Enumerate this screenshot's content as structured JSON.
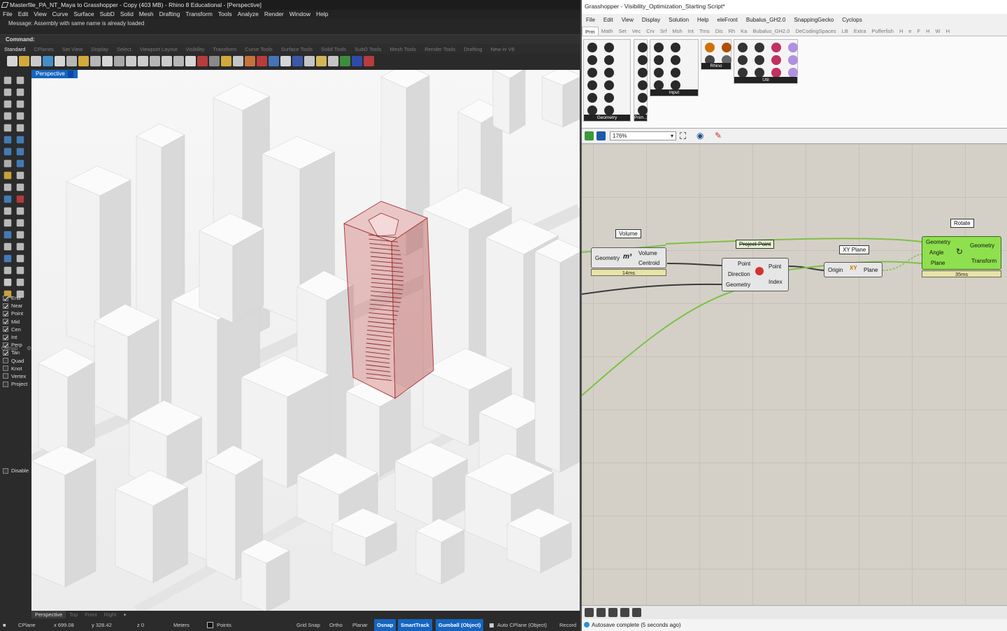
{
  "rhino": {
    "title": "Masterfile_PA_NT_Maya to Grasshopper - Copy (403 MB) - Rhino 8 Educational - [Perspective]",
    "menu": [
      "File",
      "Edit",
      "View",
      "Curve",
      "Surface",
      "SubD",
      "Solid",
      "Mesh",
      "Drafting",
      "Transform",
      "Tools",
      "Analyze",
      "Render",
      "Window",
      "Help"
    ],
    "message": "Message: Assembly with same name is already loaded",
    "command_label": "Command:",
    "toolbar_tabs": [
      "Standard",
      "CPlanes",
      "Set View",
      "Display",
      "Select",
      "Viewport Layout",
      "Visibility",
      "Transform",
      "Curve Tools",
      "Surface Tools",
      "Solid Tools",
      "SubD Tools",
      "Mesh Tools",
      "Render Tools",
      "Drafting",
      "New in V8"
    ],
    "viewport_label": "Perspective",
    "viewport_tabs": [
      "Perspective",
      "Top",
      "Front",
      "Right"
    ],
    "osnap_header": "Osnap",
    "osnap": [
      {
        "label": "End",
        "checked": true
      },
      {
        "label": "Near",
        "checked": true
      },
      {
        "label": "Point",
        "checked": true
      },
      {
        "label": "Mid",
        "checked": true
      },
      {
        "label": "Cen",
        "checked": true
      },
      {
        "label": "Int",
        "checked": true
      },
      {
        "label": "Perp",
        "checked": true
      },
      {
        "label": "Tan",
        "checked": true
      },
      {
        "label": "Quad",
        "checked": false
      },
      {
        "label": "Knot",
        "checked": false
      },
      {
        "label": "Vertex",
        "checked": false
      },
      {
        "label": "Project",
        "checked": false
      }
    ],
    "disable_label": "Disable",
    "status": {
      "cplane": "CPlane",
      "x": "x 699.08",
      "y": "y 328.42",
      "z": "z 0",
      "units": "Meters",
      "layer": "Points",
      "grid_snap": "Grid Snap",
      "ortho": "Ortho",
      "planar": "Planar",
      "osnap": "Osnap",
      "smarttrack": "SmartTrack",
      "gumball": "Gumball (Object)",
      "auto_cplane": "Auto CPlane (Object)",
      "record": "Record"
    },
    "accent": "#1565c0"
  },
  "gh": {
    "title": "Grasshopper - Visibility_Optimization_Starting Script*",
    "menu": [
      "File",
      "Edit",
      "View",
      "Display",
      "Solution",
      "Help",
      "eleFront",
      "Bubalus_GH2.0",
      "SnappingGecko",
      "Cyclops"
    ],
    "tabs": [
      "Prm",
      "Math",
      "Set",
      "Vec",
      "Crv",
      "Srf",
      "Msh",
      "Int",
      "Trns",
      "Dis",
      "Rh",
      "Ka",
      "Bubalus_GH2.0",
      "DeCodingSpaces",
      "LB",
      "Extra",
      "Pufferfish",
      "H",
      "e",
      "F",
      "H",
      "W",
      "H"
    ],
    "ribbon_groups": [
      "Geometry",
      "Prim...",
      "Input",
      "Rhino",
      "Util"
    ],
    "zoom": "176%",
    "nodes": {
      "volume": {
        "tag": "Volume",
        "input": "Geometry",
        "out1": "Volume",
        "out2": "Centroid",
        "time": "14ms"
      },
      "project": {
        "tag": "Project Point",
        "in1": "Point",
        "in2": "Direction",
        "in3": "Geometry",
        "out1": "Point",
        "out2": "Index"
      },
      "xyplane": {
        "tag": "XY Plane",
        "input": "Origin",
        "output": "Plane"
      },
      "rotate": {
        "tag": "Rotate",
        "in1": "Geometry",
        "in2": "Angle",
        "in3": "Plane",
        "out1": "Geometry",
        "out2": "Transform",
        "time": "35ms"
      }
    },
    "status": "Autosave complete (5 seconds ago)",
    "wire_color": "#7dc144",
    "node_green": "#8ee04e"
  }
}
